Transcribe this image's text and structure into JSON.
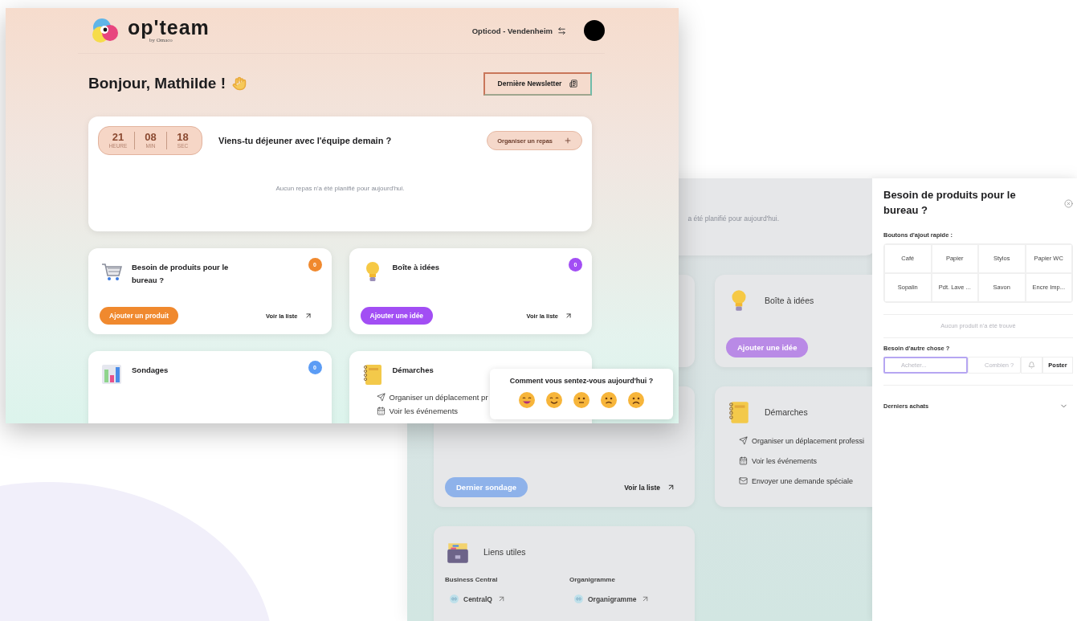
{
  "front_window": {
    "header": {
      "logo": "op'team",
      "byline": "by Omaco",
      "site": "Opticod - Vendenheim"
    },
    "greeting": "Bonjour, Mathilde !",
    "newsletter_button": "Dernière Newsletter",
    "lunch_card": {
      "countdown": [
        {
          "value": "21",
          "unit": "HEURE"
        },
        {
          "value": "08",
          "unit": "MIN"
        },
        {
          "value": "18",
          "unit": "SEC"
        }
      ],
      "question": "Viens-tu déjeuner avec l'équipe demain ?",
      "button": "Organiser un repas",
      "empty": "Aucun repas n'a été planifié pour aujourd'hui."
    },
    "cards": [
      {
        "kind": "products",
        "title": "Besoin de produits pour le bureau ?",
        "badge": "0",
        "color": "#f0892e",
        "button": "Ajouter un produit",
        "link": "Voir la liste"
      },
      {
        "kind": "ideas",
        "title": "Boîte à idées",
        "badge": "0",
        "color": "#a24ef4",
        "button": "Ajouter une idée",
        "link": "Voir la liste"
      },
      {
        "kind": "polls",
        "title": "Sondages",
        "badge": "0",
        "color": "#5b9cf5"
      },
      {
        "kind": "procedures",
        "title": "Démarches",
        "links": [
          {
            "kind": "send",
            "label": "Organiser un déplacement pr"
          },
          {
            "kind": "calendar",
            "label": "Voir les événements"
          }
        ]
      }
    ],
    "mood_popup": {
      "question": "Comment vous sentez-vous aujourd'hui ?",
      "moods": [
        {
          "kind": "grinning"
        },
        {
          "kind": "smiling"
        },
        {
          "kind": "neutral"
        },
        {
          "kind": "worried"
        },
        {
          "kind": "frowning"
        }
      ]
    }
  },
  "back_window": {
    "lunch_empty": "a été planifié pour aujourd'hui.",
    "cards": [
      {
        "kind": "products"
      },
      {
        "kind": "ideas",
        "title": "Boîte à idées",
        "color": "#b98ae6",
        "button": "Ajouter une idée"
      },
      {
        "kind": "polls",
        "color": "#8eb2ea",
        "button": "Dernier sondage",
        "link": "Voir la liste"
      },
      {
        "kind": "procedures",
        "title": "Démarches",
        "links": [
          {
            "kind": "send",
            "label": "Organiser un déplacement professi"
          },
          {
            "kind": "calendar",
            "label": "Voir les événements"
          },
          {
            "kind": "mail",
            "label": "Envoyer une demande spéciale"
          }
        ]
      },
      {
        "kind": "links",
        "title": "Liens utiles",
        "groups": [
          {
            "heading": "Business Central",
            "link": "CentralQ"
          },
          {
            "heading": "Organigramme",
            "link": "Organigramme"
          }
        ]
      }
    ],
    "drawer": {
      "title": "Besoin de produits pour le bureau ?",
      "quick_label": "Boutons d'ajout rapide :",
      "quick_buttons": [
        "Café",
        "Papier",
        "Stylos",
        "Papier WC",
        "Sopalin",
        "Pdt. Lave ...",
        "Savon",
        "Encre Imp..."
      ],
      "empty": "Aucun produit n'a été trouvé",
      "other_label": "Besoin d'autre chose ?",
      "item_field": {
        "placeholder": "Acheter...",
        "focused": true
      },
      "quantity_field": {
        "placeholder": "Combien ?",
        "focused": false
      },
      "post_button": "Poster",
      "recent": {
        "label": "Derniers achats",
        "expanded": false
      }
    }
  }
}
